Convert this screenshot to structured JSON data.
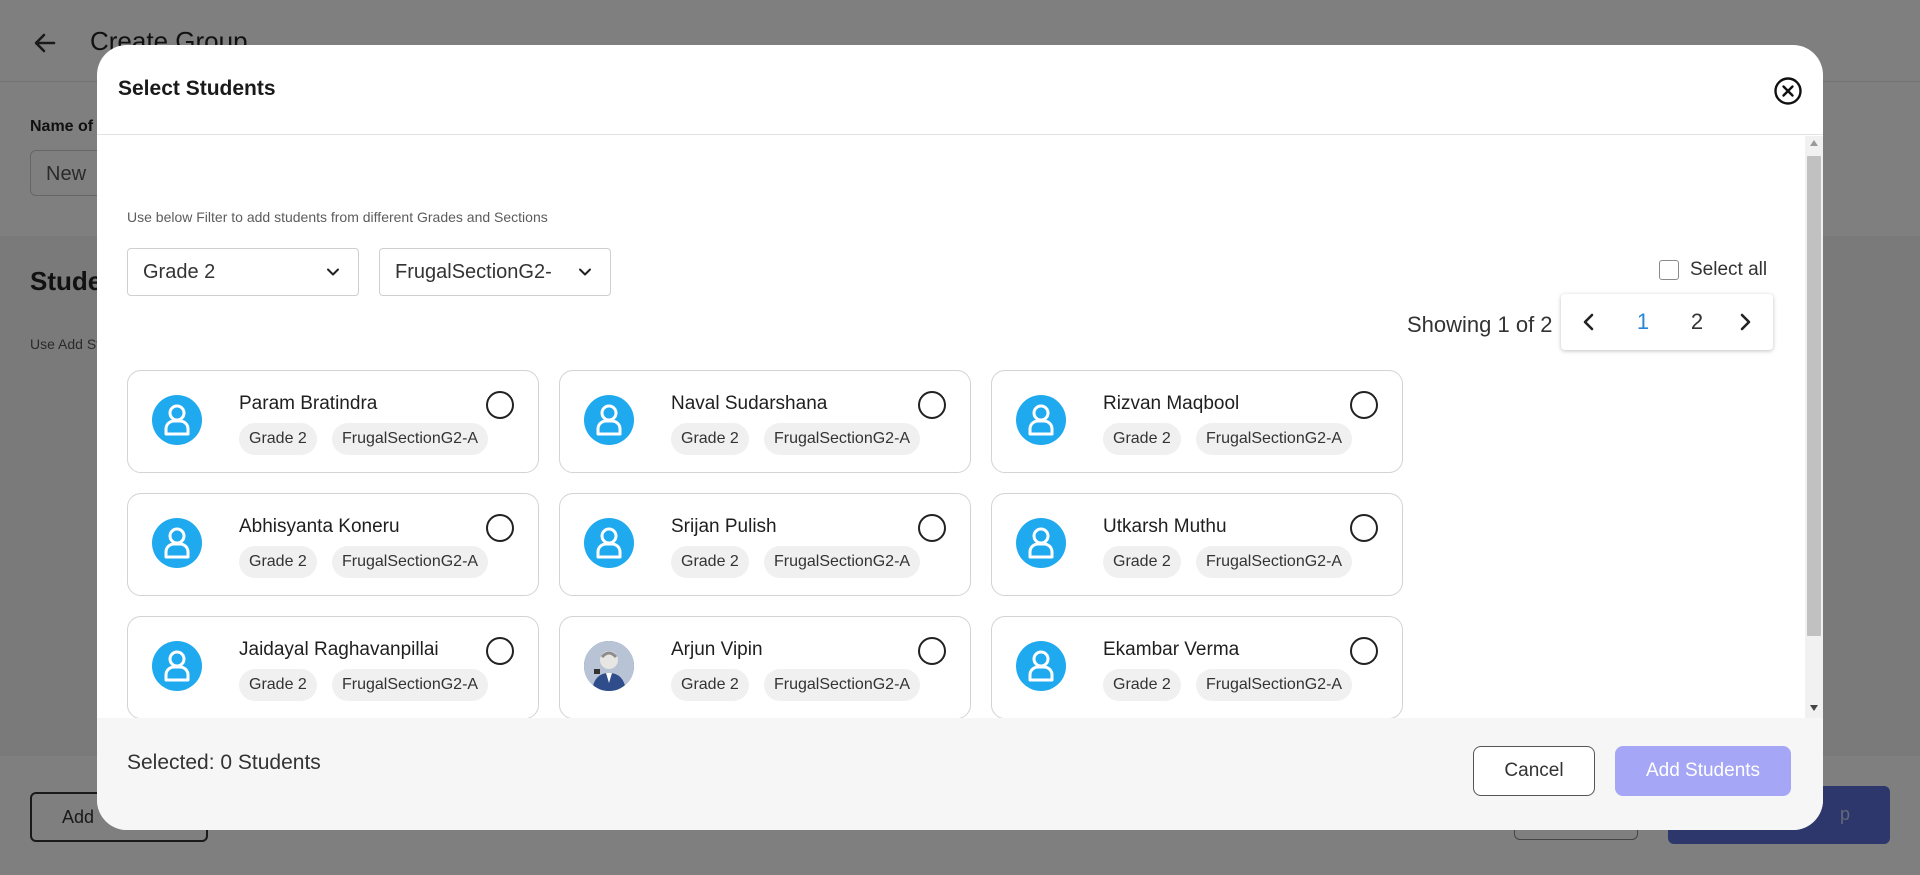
{
  "background": {
    "header_title": "Create Group",
    "name_label": "Name of",
    "name_value": "New",
    "students_title": "Stude",
    "students_hint": "Use Add St",
    "add_button": "Add",
    "create_button": "p"
  },
  "modal": {
    "title": "Select Students",
    "filter_hint": "Use below Filter to add students from different Grades and Sections",
    "grade_filter": "Grade 2",
    "section_filter": "FrugalSectionG2-",
    "select_all_label": "Select all",
    "showing_text": "Showing 1 of 2",
    "pagination": {
      "current": "1",
      "pages": [
        "1",
        "2"
      ]
    },
    "students": [
      {
        "name": "Param Bratindra",
        "grade": "Grade 2",
        "section": "FrugalSectionG2-A",
        "avatar": "default-user-icon"
      },
      {
        "name": "Naval Sudarshana",
        "grade": "Grade 2",
        "section": "FrugalSectionG2-A",
        "avatar": "default-user-icon"
      },
      {
        "name": "Rizvan Maqbool",
        "grade": "Grade 2",
        "section": "FrugalSectionG2-A",
        "avatar": "default-user-icon"
      },
      {
        "name": "Abhisyanta Koneru",
        "grade": "Grade 2",
        "section": "FrugalSectionG2-A",
        "avatar": "default-user-icon"
      },
      {
        "name": "Srijan Pulish",
        "grade": "Grade 2",
        "section": "FrugalSectionG2-A",
        "avatar": "default-user-icon"
      },
      {
        "name": "Utkarsh Muthu",
        "grade": "Grade 2",
        "section": "FrugalSectionG2-A",
        "avatar": "default-user-icon"
      },
      {
        "name": "Jaidayal Raghavanpillai",
        "grade": "Grade 2",
        "section": "FrugalSectionG2-A",
        "avatar": "default-user-icon"
      },
      {
        "name": "Arjun Vipin",
        "grade": "Grade 2",
        "section": "FrugalSectionG2-A",
        "avatar": "photo"
      },
      {
        "name": "Ekambar Verma",
        "grade": "Grade 2",
        "section": "FrugalSectionG2-A",
        "avatar": "default-user-icon"
      }
    ],
    "selected_text": "Selected: 0 Students",
    "cancel_label": "Cancel",
    "add_label": "Add Students"
  },
  "colors": {
    "avatar_blue": "#1fa9ef",
    "primary_disabled": "#a5a6f6",
    "page_link": "#2a87d8"
  }
}
